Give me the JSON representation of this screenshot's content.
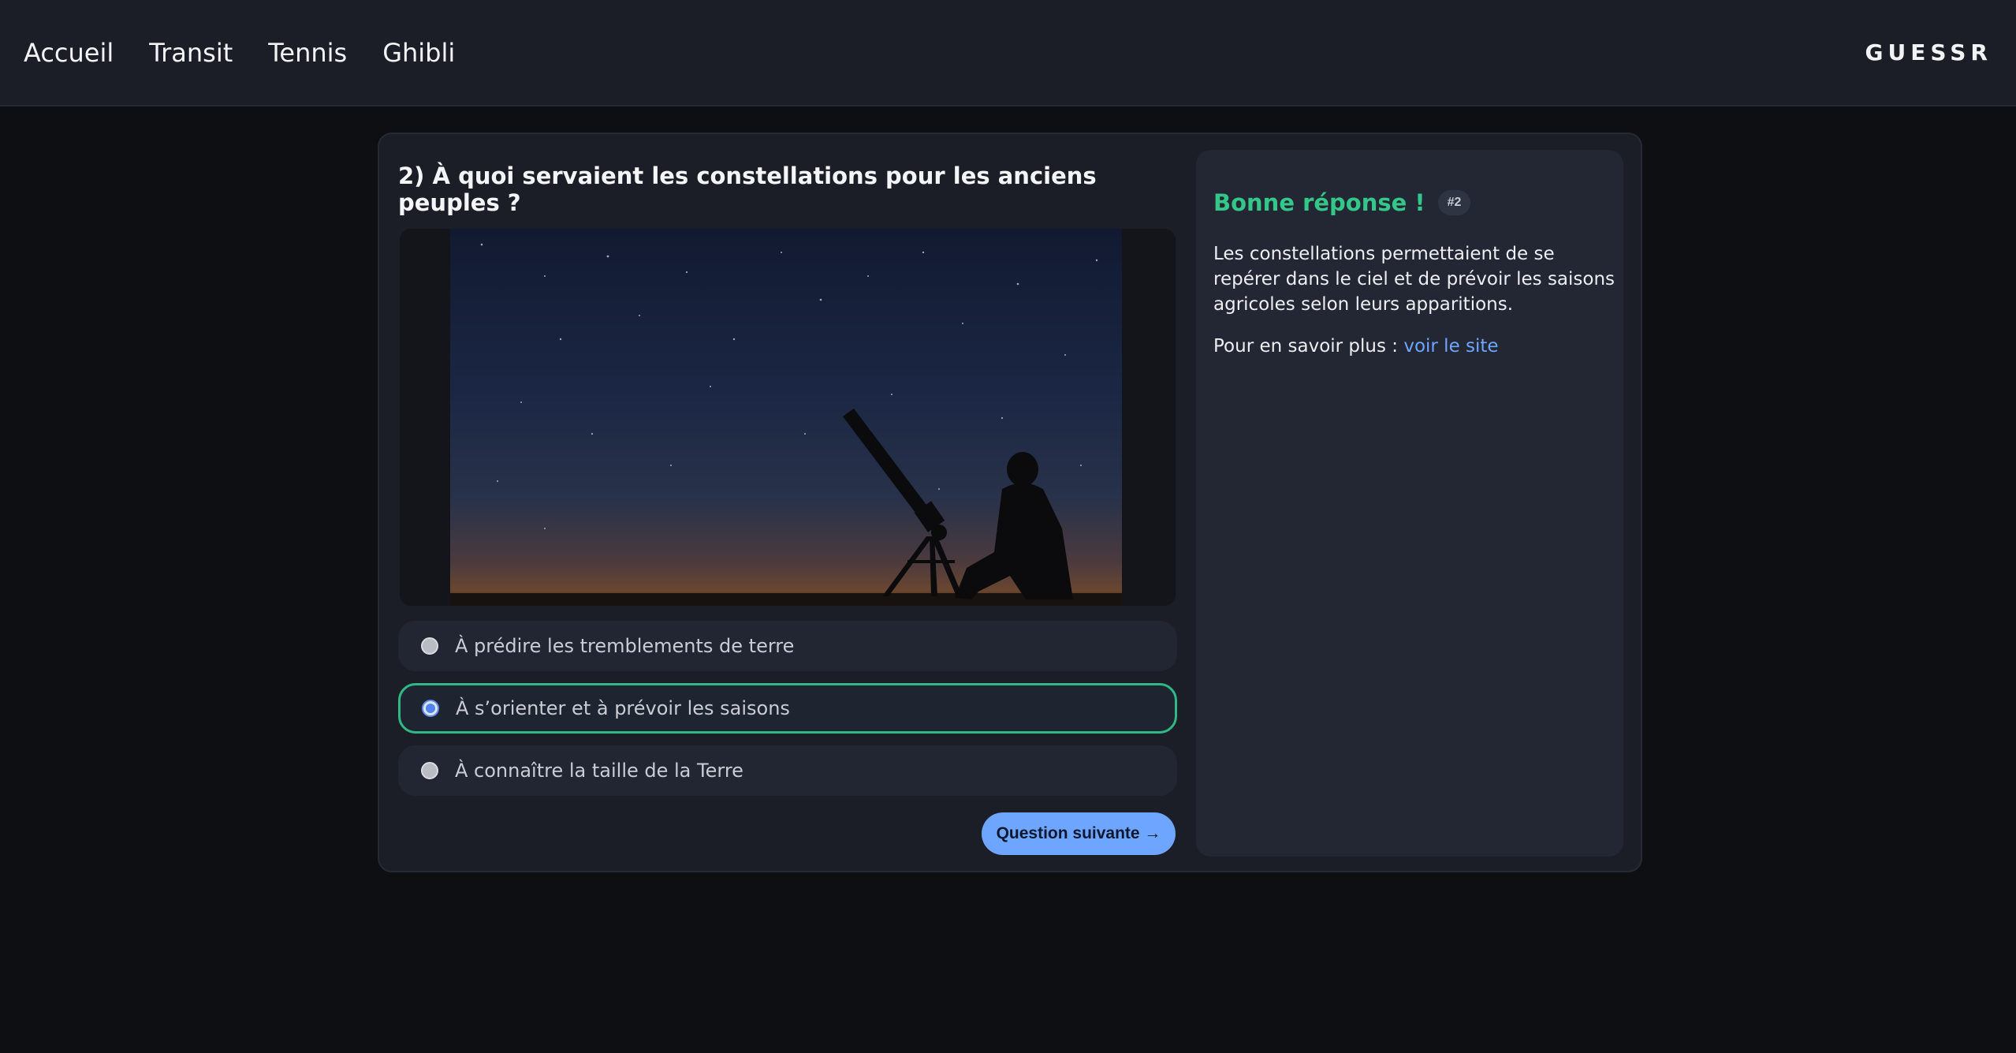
{
  "nav": {
    "items": [
      {
        "label": "Accueil"
      },
      {
        "label": "Transit"
      },
      {
        "label": "Tennis"
      },
      {
        "label": "Ghibli"
      }
    ],
    "brand": "GUESSR"
  },
  "quiz": {
    "question": "2) À quoi servaient les constellations pour les anciens peuples ?",
    "options": [
      {
        "label": "À prédire les tremblements de terre",
        "selected": false
      },
      {
        "label": "À s’orienter et à prévoir les saisons",
        "selected": true
      },
      {
        "label": "À connaître la taille de la Terre",
        "selected": false
      }
    ],
    "next_label": "Question suivante →"
  },
  "feedback": {
    "title": "Bonne réponse !",
    "badge": "#2",
    "explanation": "Les constellations permettaient de se repérer dans le ciel et de prévoir les saisons agricoles selon leurs apparitions.",
    "more_prefix": "Pour en savoir plus : ",
    "more_link": "voir le site"
  },
  "colors": {
    "accent_green": "#34c78a",
    "accent_blue": "#6ea6ff",
    "selected_border": "#2fb886"
  }
}
